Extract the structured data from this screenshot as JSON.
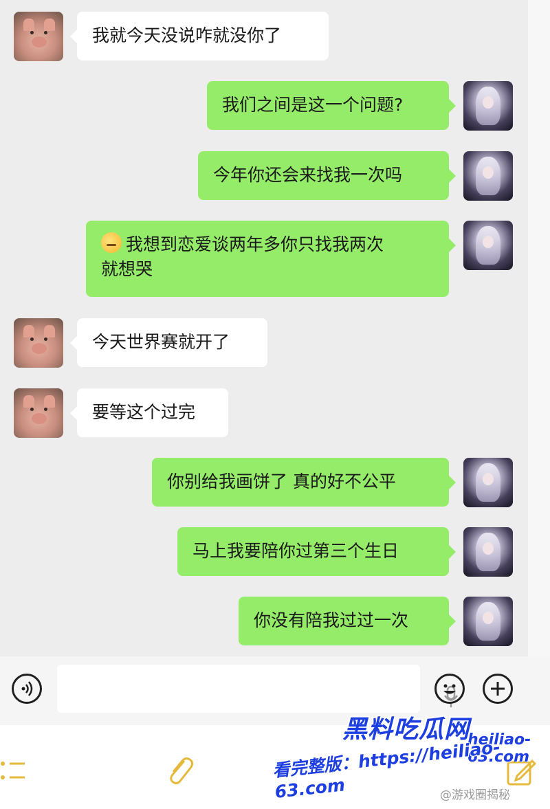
{
  "messages": [
    {
      "side": "in",
      "avatar": "pig-avatar",
      "text": "我就今天没说咋就没你了"
    },
    {
      "side": "out",
      "avatar": "anime-girl-avatar",
      "text": "我们之间是这一个问题?"
    },
    {
      "side": "out",
      "avatar": "anime-girl-avatar",
      "text": "今年你还会来找我一次吗"
    },
    {
      "side": "out",
      "avatar": "anime-girl-avatar",
      "emoji": "pensive-face-emoji",
      "text": "我想到恋爱谈两年多你只找我两次\n就想哭"
    },
    {
      "side": "in",
      "avatar": "pig-avatar",
      "text": "今天世界赛就开了"
    },
    {
      "side": "in",
      "avatar": "pig-avatar",
      "text": "要等这个过完"
    },
    {
      "side": "out",
      "avatar": "anime-girl-avatar",
      "text": "你别给我画饼了 真的好不公平"
    },
    {
      "side": "out",
      "avatar": "anime-girl-avatar",
      "text": "马上我要陪你过第三个生日"
    },
    {
      "side": "out",
      "avatar": "anime-girl-avatar",
      "text": "你没有陪我过过一次"
    }
  ],
  "input_bar": {
    "voice_icon": "voice-icon",
    "mic_icon": "microphone-icon",
    "emoji_icon": "emoji-icon",
    "plus_icon": "plus-icon"
  },
  "toolbar": {
    "icons": [
      "list-icon",
      "attachment-icon",
      "edit-icon"
    ]
  },
  "watermark": {
    "title": "黑料吃瓜网",
    "url": "heiliao-63.com",
    "line": "看完整版：https://heiliao-63.com",
    "weibo": "@游戏圈揭秘"
  },
  "colors": {
    "chat_background": "#ededed",
    "outgoing_bubble": "#95ec69",
    "incoming_bubble": "#ffffff",
    "watermark_blue": "#1e3fe0",
    "toolbar_icon": "#e5b93b"
  }
}
